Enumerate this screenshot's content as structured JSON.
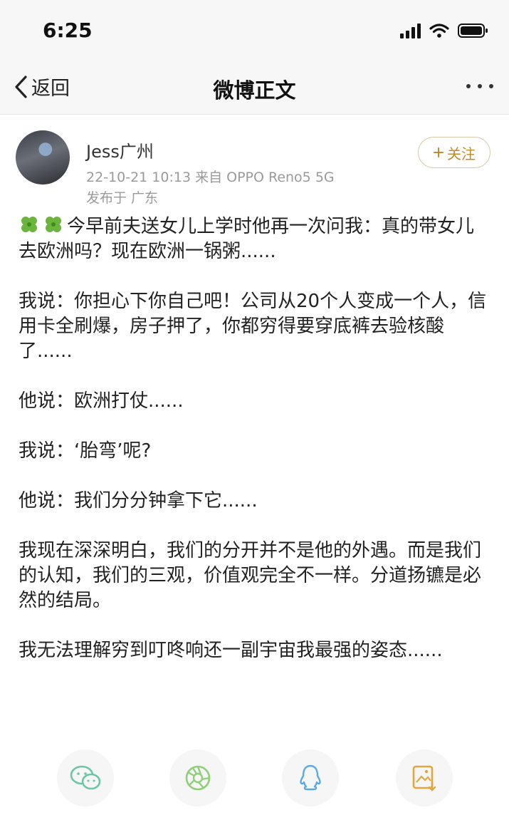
{
  "status_bar": {
    "time": "6:25"
  },
  "nav": {
    "back_label": "返回",
    "title": "微博正文"
  },
  "author": {
    "name": "Jess广州",
    "meta": "22-10-21 10:13  来自 OPPO Reno5 5G",
    "location": "发布于 广东",
    "follow_label": "关注"
  },
  "post": {
    "paragraphs": [
      "今早前夫送女儿上学时他再一次问我：真的带女儿去欧洲吗？现在欧洲一锅粥......",
      "我说：你担心下你自己吧！公司从20个人变成一个人，信用卡全刷爆，房子押了，你都穷得要穿底裤去验核酸了......",
      "他说：欧洲打仗......",
      "我说：‘胎弯’呢?",
      "他说：我们分分钟拿下它......",
      "我现在深深明白，我们的分开并不是他的外遇。而是我们的认知，我们的三观，价值观完全不一样。分道扬镳是必然的结局。",
      "我无法理解穷到叮咚响还一副宇宙我最强的姿态......"
    ]
  },
  "share": {
    "items": [
      "wechat-icon",
      "moments-icon",
      "qq-icon",
      "save-image-icon"
    ],
    "colors": {
      "wechat": "#6cc5a8",
      "moments": "#8fcf7a",
      "qq": "#5aa9e6",
      "save": "#e0a640"
    }
  },
  "colors": {
    "accent": "#c08a2e",
    "meta_gray": "#9a9a9a"
  }
}
